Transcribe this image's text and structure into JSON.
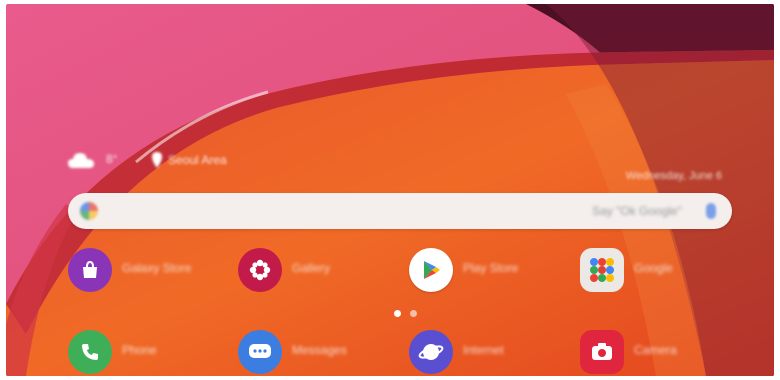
{
  "status": {
    "weather_icon": "cloud-icon",
    "weather_text": "8°",
    "location_icon": "location-pin-icon",
    "location_text": "Seoul Area",
    "date_text": "Wednesday, June 6"
  },
  "search": {
    "icon": "google-icon",
    "placeholder": "Say \"Ok Google\"",
    "mic_icon": "mic-icon"
  },
  "apps": [
    {
      "name": "Galaxy Store",
      "icon": "shopping-bag-icon",
      "color": "#8a35b8"
    },
    {
      "name": "Gallery",
      "icon": "flower-icon",
      "color": "#c21b4a"
    },
    {
      "name": "Play Store",
      "icon": "play-store-icon",
      "color": "#ffffff"
    },
    {
      "name": "Google",
      "icon": "google-folder-icon",
      "color": "#ece8e6"
    },
    {
      "name": "Phone",
      "icon": "phone-icon",
      "color": "#3fae59"
    },
    {
      "name": "Messages",
      "icon": "messages-icon",
      "color": "#3b7de0"
    },
    {
      "name": "Internet",
      "icon": "internet-icon",
      "color": "#5a4fd0"
    },
    {
      "name": "Camera",
      "icon": "camera-icon",
      "color": "#e0263f"
    }
  ],
  "page_indicator": {
    "pages": 2,
    "current": 1
  }
}
